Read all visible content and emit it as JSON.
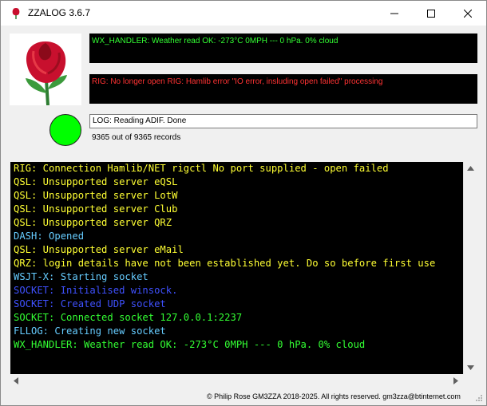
{
  "window": {
    "title": "ZZALOG 3.6.7"
  },
  "wx_panel": {
    "text": "WX_HANDLER: Weather read OK:  -273°C 0MPH --- 0 hPa. 0% cloud",
    "color": "#33ff33"
  },
  "rig_panel": {
    "text": "RIG: No longer open RIG: Hamlib error \"IO error, insluding open failed\" processing",
    "color": "#ff3333"
  },
  "log": {
    "status": "LOG: Reading ADIF. Done",
    "records": "9365 out of 9365 records"
  },
  "console": {
    "lines": [
      {
        "text": "RIG: Connection Hamlib/NET rigctl No port supplied - open failed",
        "color": "#ffff33"
      },
      {
        "text": "QSL: Unsupported server eQSL",
        "color": "#ffff33"
      },
      {
        "text": "QSL: Unsupported server LotW",
        "color": "#ffff33"
      },
      {
        "text": "QSL: Unsupported server Club",
        "color": "#ffff33"
      },
      {
        "text": "QSL: Unsupported server QRZ",
        "color": "#ffff33"
      },
      {
        "text": "DASH: Opened",
        "color": "#66ccff"
      },
      {
        "text": "QSL: Unsupported server eMail",
        "color": "#ffff33"
      },
      {
        "text": "QRZ: login details have not been established yet. Do so before first use",
        "color": "#ffff33"
      },
      {
        "text": "WSJT-X: Starting socket",
        "color": "#66ccff"
      },
      {
        "text": "SOCKET: Initialised winsock.",
        "color": "#3f51ff"
      },
      {
        "text": "SOCKET: Created UDP socket",
        "color": "#3f51ff"
      },
      {
        "text": "SOCKET: Connected socket 127.0.0.1:2237",
        "color": "#33ff33"
      },
      {
        "text": "FLLOG: Creating new socket",
        "color": "#66ccff"
      },
      {
        "text": "WX_HANDLER: Weather read OK:  -273°C 0MPH --- 0 hPa. 0% cloud",
        "color": "#33ff33"
      }
    ]
  },
  "footer": {
    "text": "© Philip Rose GM3ZZA 2018-2025. All rights reserved. gm3zza@btinternet.com"
  },
  "icons": {
    "app": "rose-icon",
    "led": "status-led-green"
  }
}
